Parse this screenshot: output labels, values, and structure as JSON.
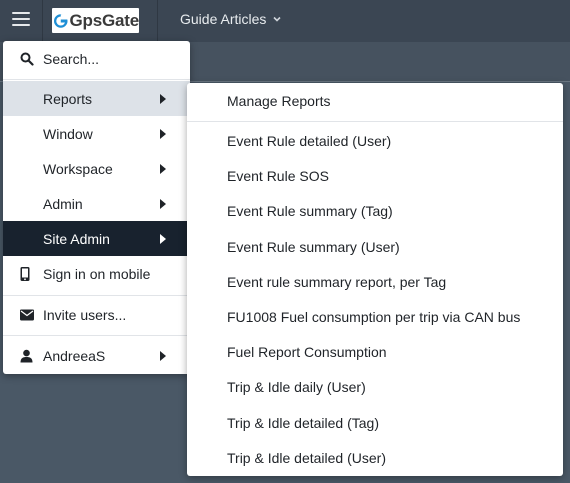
{
  "header": {
    "logo_text": "GpsGate",
    "app_title": "Guide Articles"
  },
  "menu": {
    "search_label": "Search...",
    "items": [
      {
        "label": "Reports"
      },
      {
        "label": "Window"
      },
      {
        "label": "Workspace"
      },
      {
        "label": "Admin"
      },
      {
        "label": "Site Admin"
      }
    ],
    "sign_in_mobile_label": "Sign in on mobile",
    "invite_users_label": "Invite users...",
    "user_label": "AndreeaS"
  },
  "submenu": {
    "manage_label": "Manage Reports",
    "reports": [
      "Event Rule detailed (User)",
      "Event Rule SOS",
      "Event Rule summary (Tag)",
      "Event Rule summary (User)",
      "Event rule summary report, per Tag",
      "FU1008 Fuel consumption per trip via CAN bus",
      "Fuel Report Consumption",
      "Trip & Idle daily (User)",
      "Trip & Idle detailed (Tag)",
      "Trip & Idle detailed (User)"
    ]
  },
  "colors": {
    "topbar": "#3b4653",
    "background": "#4a5866",
    "active_item": "#18222e",
    "hover_item": "#dde2e8",
    "logo_accent": "#1e8fd6"
  },
  "icons": {
    "menu": "hamburger-icon",
    "search": "search-icon",
    "mobile": "mobile-phone-icon",
    "invite": "envelope-icon",
    "user": "user-icon"
  }
}
